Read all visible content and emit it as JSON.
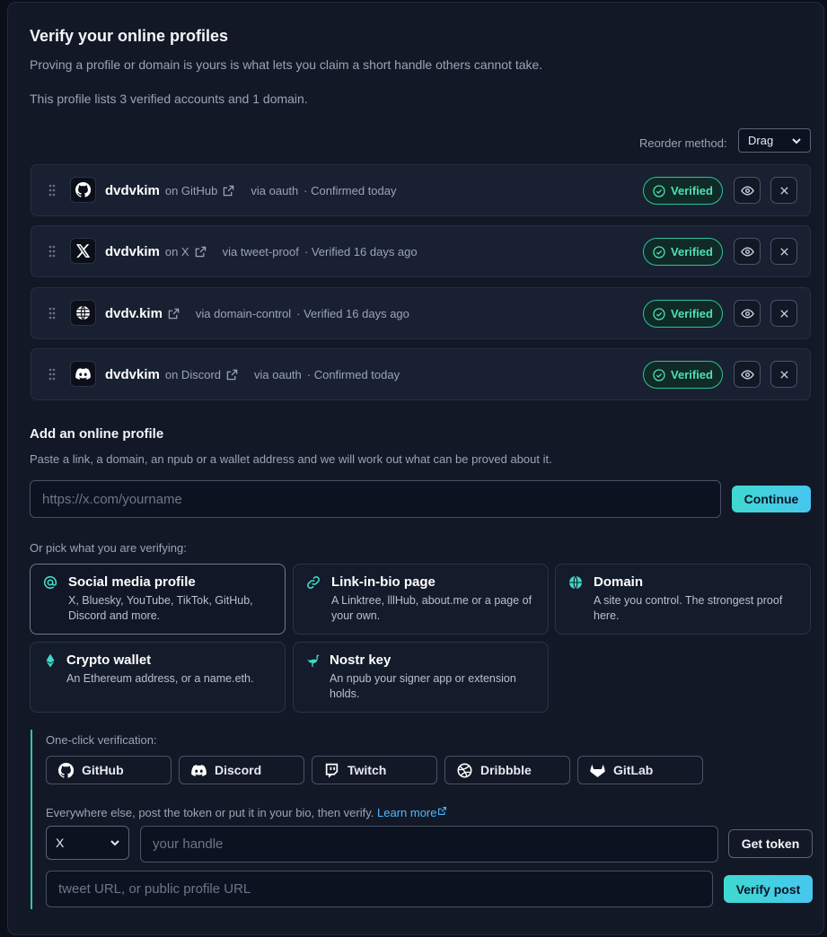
{
  "header": {
    "title": "Verify your online profiles",
    "subtitle": "Proving a profile or domain is yours is what lets you claim a short handle others cannot take.",
    "summary": "This profile lists 3 verified accounts and 1 domain."
  },
  "reorder": {
    "label": "Reorder method:",
    "value": "Drag"
  },
  "profiles": [
    {
      "icon": "github-icon",
      "handle": "dvdvkim",
      "platform": "on GitHub",
      "method": "via oauth",
      "status_time": "· Confirmed today",
      "badge": "Verified"
    },
    {
      "icon": "x-icon",
      "handle": "dvdvkim",
      "platform": "on X",
      "method": "via tweet-proof",
      "status_time": "· Verified 16 days ago",
      "badge": "Verified"
    },
    {
      "icon": "globe-icon",
      "handle": "dvdv.kim",
      "platform": "",
      "method": "via domain-control",
      "status_time": "· Verified 16 days ago",
      "badge": "Verified"
    },
    {
      "icon": "discord-icon",
      "handle": "dvdvkim",
      "platform": "on Discord",
      "method": "via oauth",
      "status_time": "· Confirmed today",
      "badge": "Verified"
    }
  ],
  "add": {
    "title": "Add an online profile",
    "description": "Paste a link, a domain, an npub or a wallet address and we will work out what can be proved about it.",
    "input_placeholder": "https://x.com/yourname",
    "continue_label": "Continue",
    "pick_label": "Or pick what you are verifying:"
  },
  "types": [
    {
      "icon": "at-icon",
      "title": "Social media profile",
      "description": "X, Bluesky, YouTube, TikTok, GitHub, Discord and more.",
      "selected": true
    },
    {
      "icon": "link-icon",
      "title": "Link-in-bio page",
      "description": "A Linktree, lllHub, about.me or a page of your own.",
      "selected": false
    },
    {
      "icon": "globe-icon",
      "title": "Domain",
      "description": "A site you control. The strongest proof here.",
      "selected": false
    },
    {
      "icon": "ethereum-icon",
      "title": "Crypto wallet",
      "description": "An Ethereum address, or a name.eth.",
      "selected": false
    },
    {
      "icon": "ostrich-icon",
      "title": "Nostr key",
      "description": "An npub your signer app or extension holds.",
      "selected": false
    }
  ],
  "oneclick": {
    "label": "One-click verification:",
    "buttons": [
      {
        "icon": "github-icon",
        "label": "GitHub"
      },
      {
        "icon": "discord-icon",
        "label": "Discord"
      },
      {
        "icon": "twitch-icon",
        "label": "Twitch"
      },
      {
        "icon": "dribbble-icon",
        "label": "Dribbble"
      },
      {
        "icon": "gitlab-icon",
        "label": "GitLab"
      }
    ],
    "elsewhere_text": "Everywhere else, post the token or put it in your bio, then verify.",
    "learn_more": "Learn more",
    "platform_value": "X",
    "handle_placeholder": "your handle",
    "get_token_label": "Get token",
    "url_placeholder": "tweet URL, or public profile URL",
    "verify_label": "Verify post"
  },
  "colors": {
    "accent": "#3fd9d0",
    "verified": "#4fe0b0",
    "link": "#4fb7ff",
    "background": "#121826"
  }
}
